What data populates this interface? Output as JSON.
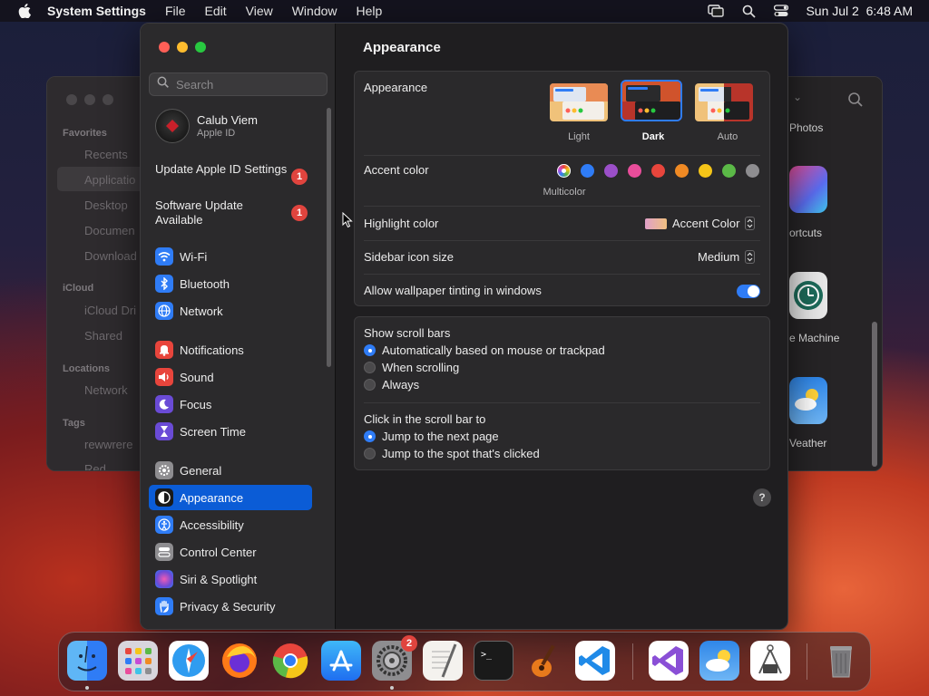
{
  "menubar": {
    "app_name": "System Settings",
    "menus": [
      "File",
      "Edit",
      "View",
      "Window",
      "Help"
    ],
    "datetime": "Sun Jul 2  6:48 AM"
  },
  "finder": {
    "sections": {
      "favorites": "Favorites",
      "icloud": "iCloud",
      "locations": "Locations",
      "tags": "Tags"
    },
    "items": {
      "recents": "Recents",
      "applications": "Applicatio",
      "desktop": "Desktop",
      "documents": "Documen",
      "downloads": "Download",
      "icloud_drive": "iCloud Dri",
      "shared": "Shared",
      "network": "Network",
      "tag1": "rewwrere",
      "tag2": "Red"
    },
    "app_labels": {
      "photos": "Photos",
      "shortcuts": "ortcuts",
      "time_machine": "e Machine",
      "weather": "Veather"
    }
  },
  "settings": {
    "search_placeholder": "Search",
    "profile": {
      "name": "Calub Viem",
      "subtitle": "Apple ID"
    },
    "notices": [
      {
        "label": "Update Apple ID Settings",
        "badge": "1"
      },
      {
        "label": "Software Update Available",
        "badge": "1"
      }
    ],
    "nav": [
      {
        "label": "Wi-Fi",
        "icon": "wifi-icon",
        "color": "#2f7cf6"
      },
      {
        "label": "Bluetooth",
        "icon": "bluetooth-icon",
        "color": "#2f7cf6"
      },
      {
        "label": "Network",
        "icon": "globe-icon",
        "color": "#2f7cf6"
      },
      {
        "label": "Notifications",
        "icon": "bell-icon",
        "color": "#e8453c"
      },
      {
        "label": "Sound",
        "icon": "speaker-icon",
        "color": "#e8453c"
      },
      {
        "label": "Focus",
        "icon": "moon-icon",
        "color": "#6a4bd6"
      },
      {
        "label": "Screen Time",
        "icon": "hourglass-icon",
        "color": "#6a4bd6"
      },
      {
        "label": "General",
        "icon": "gear-icon",
        "color": "#8e8d90"
      },
      {
        "label": "Appearance",
        "icon": "appearance-icon",
        "color": "#1a1a1a"
      },
      {
        "label": "Accessibility",
        "icon": "accessibility-icon",
        "color": "#2f7cf6"
      },
      {
        "label": "Control Center",
        "icon": "control-center-icon",
        "color": "#8e8d90"
      },
      {
        "label": "Siri & Spotlight",
        "icon": "siri-icon",
        "color": "#b33bd6"
      },
      {
        "label": "Privacy & Security",
        "icon": "hand-icon",
        "color": "#2f7cf6"
      }
    ],
    "selected_nav": "Appearance",
    "main": {
      "title": "Appearance",
      "appearance_label": "Appearance",
      "themes": [
        "Light",
        "Dark",
        "Auto"
      ],
      "selected_theme": "Dark",
      "accent_label": "Accent color",
      "accent_selected_name": "Multicolor",
      "accent_colors": [
        "#c74bd6",
        "#2f7cf6",
        "#9b4fc9",
        "#e94d9b",
        "#e8453c",
        "#f08a24",
        "#f5c518",
        "#5bb947",
        "#8e8d90"
      ],
      "highlight_label": "Highlight color",
      "highlight_value": "Accent Color",
      "sidebar_icon_label": "Sidebar icon size",
      "sidebar_icon_value": "Medium",
      "tinting_label": "Allow wallpaper tinting in windows",
      "tinting_on": true,
      "scroll_bars_label": "Show scroll bars",
      "scroll_bar_options": [
        "Automatically based on mouse or trackpad",
        "When scrolling",
        "Always"
      ],
      "scroll_bar_selected": "Automatically based on mouse or trackpad",
      "click_label": "Click in the scroll bar to",
      "click_options": [
        "Jump to the next page",
        "Jump to the spot that's clicked"
      ],
      "click_selected": "Jump to the next page",
      "help": "?"
    }
  },
  "dock": {
    "apps": [
      "Finder",
      "Launchpad",
      "Safari",
      "Firefox",
      "Chrome",
      "App Store",
      "System Settings",
      "TextEdit",
      "Terminal",
      "GarageBand",
      "VS Code",
      "Visual Studio",
      "Weather",
      "Instruments",
      "Trash"
    ],
    "settings_badge": "2"
  }
}
